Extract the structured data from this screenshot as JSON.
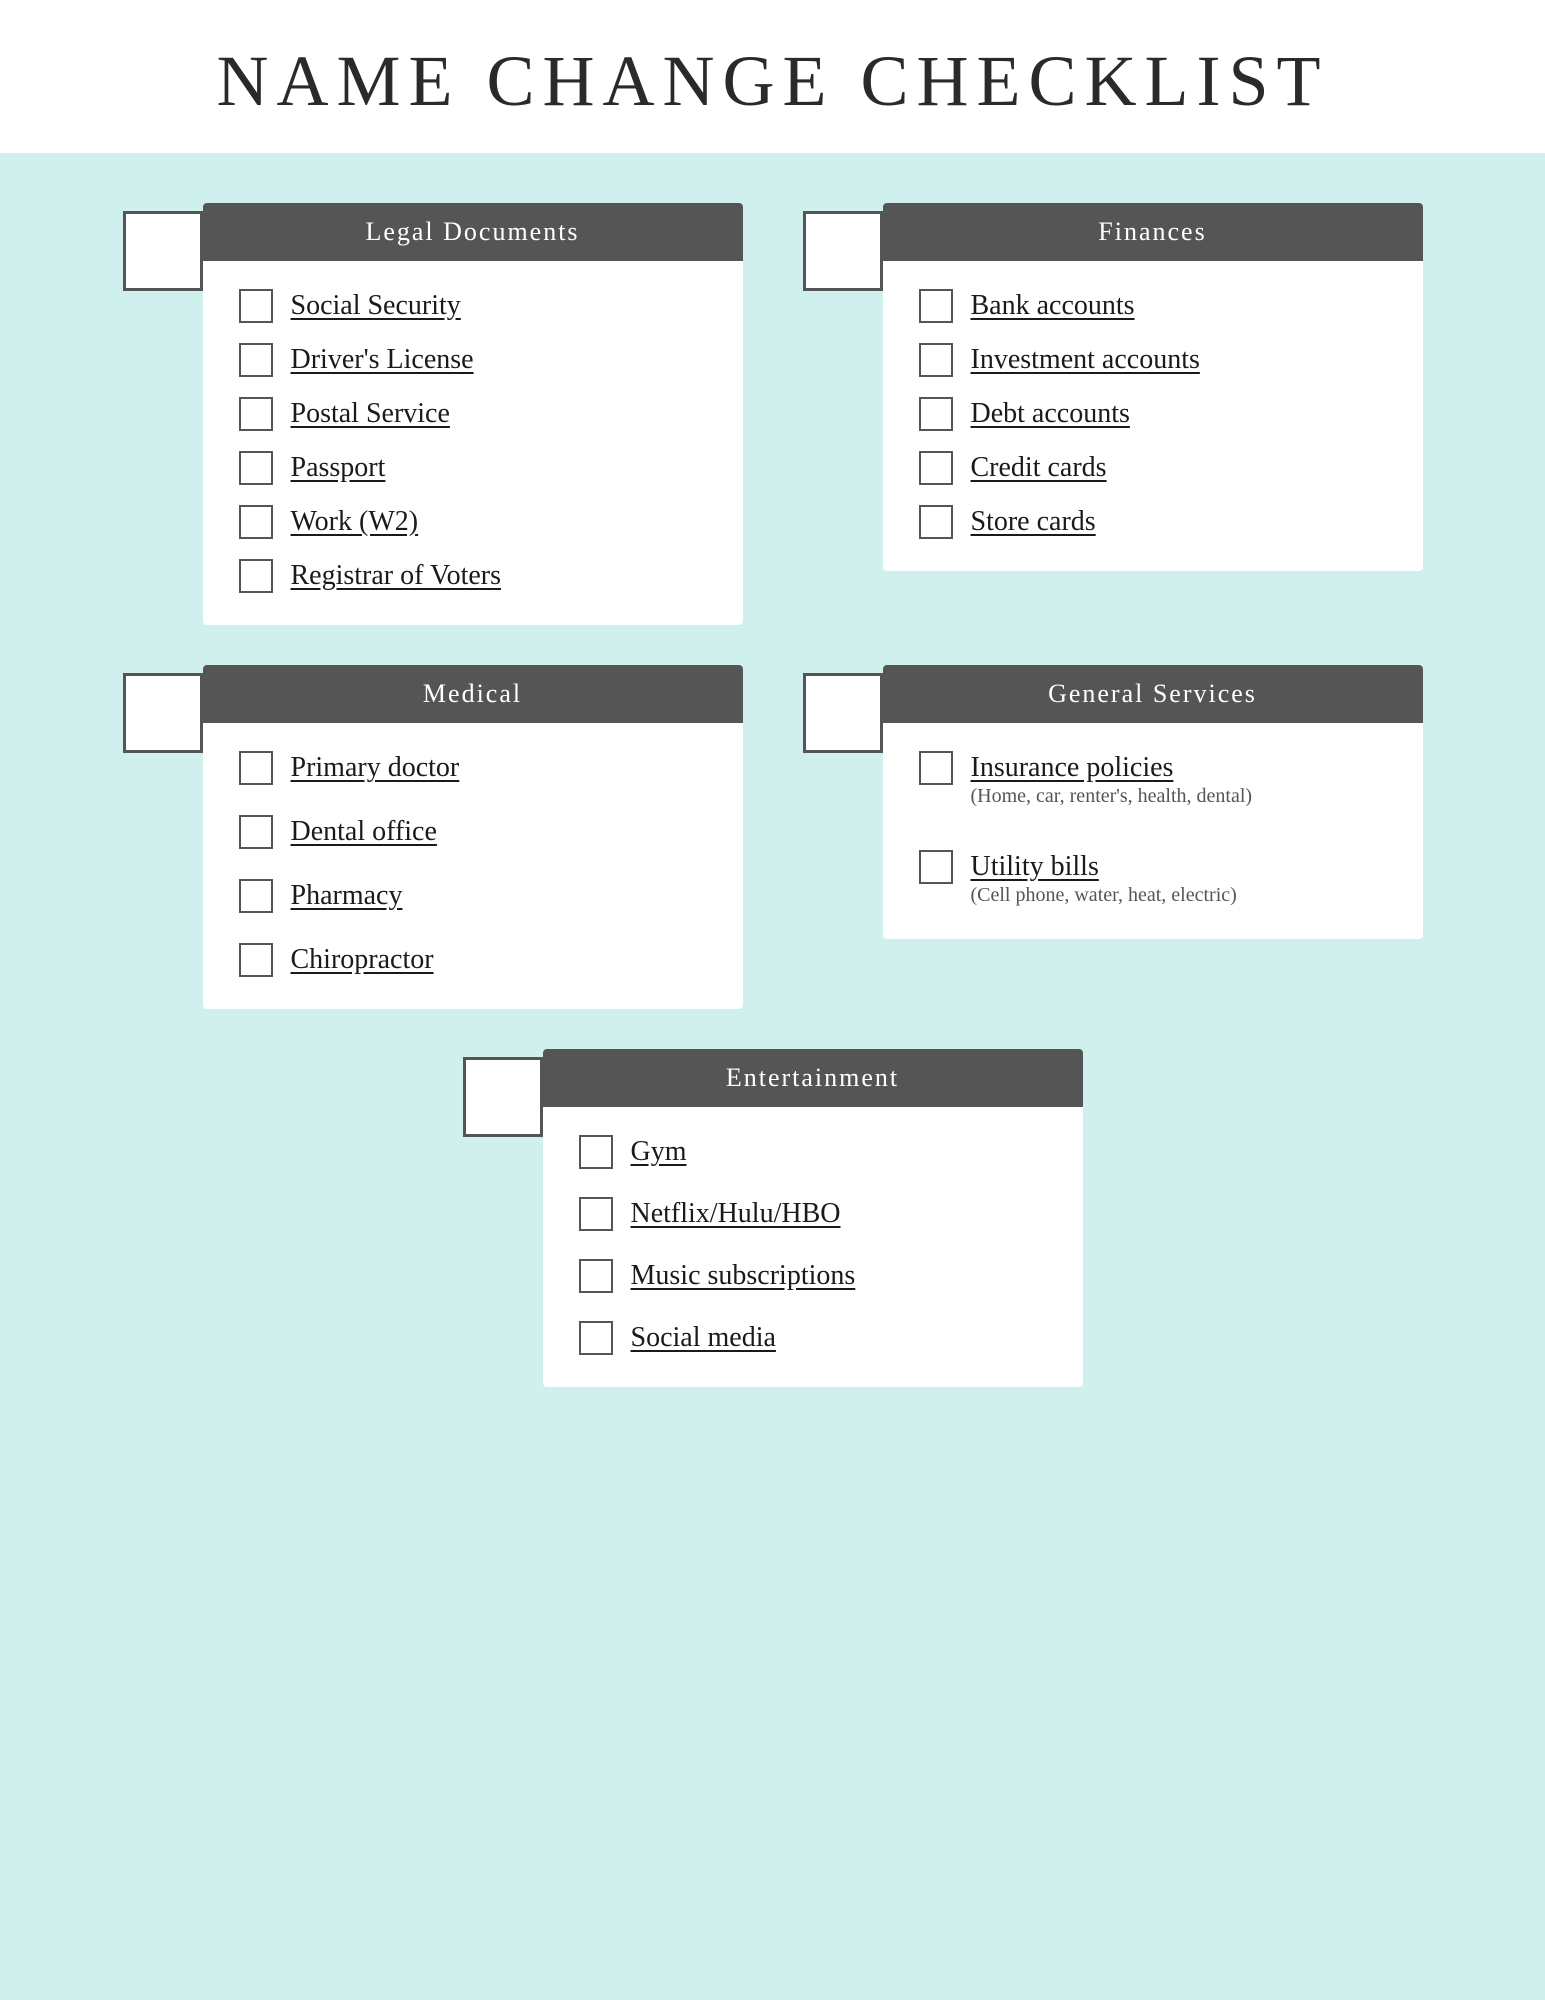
{
  "title": "NAME CHANGE CHECKLIST",
  "sections": {
    "legal": {
      "header": "Legal Documents",
      "items": [
        {
          "label": "Social Security"
        },
        {
          "label": "Driver's License"
        },
        {
          "label": "Postal Service"
        },
        {
          "label": "Passport"
        },
        {
          "label": "Work (W2)"
        },
        {
          "label": "Registrar of Voters"
        }
      ]
    },
    "finances": {
      "header": "Finances",
      "items": [
        {
          "label": "Bank accounts"
        },
        {
          "label": "Investment accounts"
        },
        {
          "label": "Debt accounts"
        },
        {
          "label": "Credit cards"
        },
        {
          "label": "Store cards"
        }
      ]
    },
    "medical": {
      "header": "Medical",
      "items": [
        {
          "label": "Primary doctor"
        },
        {
          "label": "Dental office"
        },
        {
          "label": "Pharmacy"
        },
        {
          "label": "Chiropractor"
        }
      ]
    },
    "general": {
      "header": "General Services",
      "items": [
        {
          "label": "Insurance policies",
          "sub": "(Home, car, renter's, health, dental)"
        },
        {
          "label": "Utility bills",
          "sub": "(Cell phone, water, heat, electric)"
        }
      ]
    },
    "entertainment": {
      "header": "Entertainment",
      "items": [
        {
          "label": "Gym"
        },
        {
          "label": "Netflix/Hulu/HBO"
        },
        {
          "label": "Music subscriptions"
        },
        {
          "label": "Social media"
        }
      ]
    }
  }
}
